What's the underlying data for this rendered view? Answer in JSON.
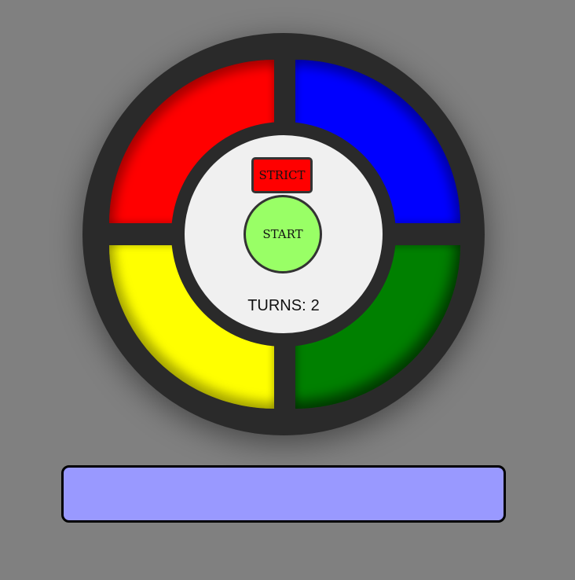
{
  "game": {
    "pads": [
      {
        "id": "red",
        "color": "#ff0000"
      },
      {
        "id": "blue",
        "color": "#0000ff"
      },
      {
        "id": "yellow",
        "color": "#ffff00"
      },
      {
        "id": "green",
        "color": "#008000"
      }
    ],
    "strict_label": "STRICT",
    "strict_color": "#ff0000",
    "start_label": "START",
    "start_color": "#99ff66",
    "turns_label": "TURNS:",
    "turns_value": "2"
  },
  "message": {
    "text": "",
    "color": "#9999ff"
  },
  "background_color": "#808080",
  "board_color": "#2a2a2a"
}
